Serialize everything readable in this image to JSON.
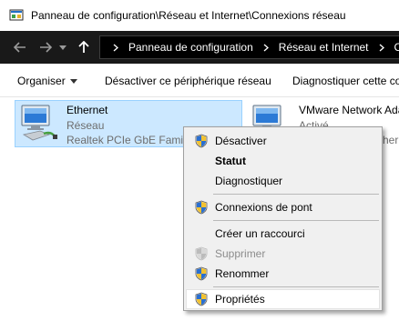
{
  "window": {
    "title": "Panneau de configuration\\Réseau et Internet\\Connexions réseau"
  },
  "address_bar": {
    "crumbs": [
      "Panneau de configuration",
      "Réseau et Internet",
      "Co"
    ]
  },
  "command_bar": {
    "organize_label": "Organiser",
    "disable_label": "Désactiver ce périphérique réseau",
    "diagnose_label": "Diagnostiquer cette co"
  },
  "adapters": [
    {
      "name": "Ethernet",
      "status": "Réseau",
      "device": "Realtek PCIe GbE Family"
    },
    {
      "name": "VMware Network Ada",
      "status": "Activé",
      "device": "her"
    }
  ],
  "context_menu": {
    "items": [
      {
        "label": "Désactiver",
        "icon": "shield-icon"
      },
      {
        "label": "Statut"
      },
      {
        "label": "Diagnostiquer"
      },
      {
        "label": "Connexions de pont",
        "icon": "shield-icon"
      },
      {
        "label": "Créer un raccourci"
      },
      {
        "label": "Supprimer",
        "icon": "shield-icon",
        "disabled": true
      },
      {
        "label": "Renommer",
        "icon": "shield-icon"
      },
      {
        "label": "Propriétés",
        "icon": "shield-icon"
      }
    ]
  },
  "colors": {
    "selection": "#cce8ff",
    "selection_border": "#99d1ff",
    "addressbar_bg": "#191919",
    "menu_bg": "#f0f0f0"
  }
}
